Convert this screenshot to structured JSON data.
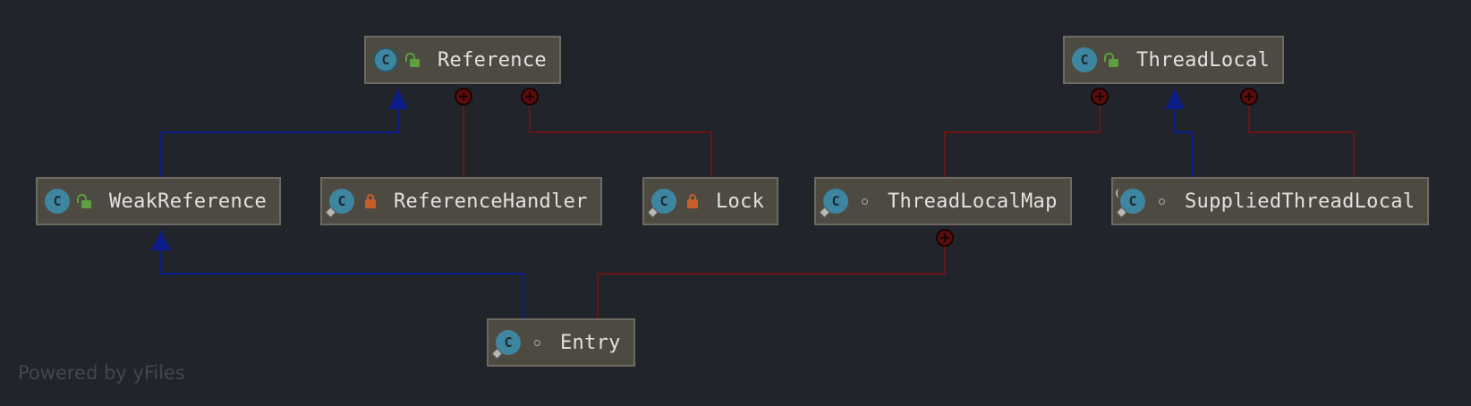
{
  "diagram": {
    "nodes": [
      {
        "id": "reference",
        "label": "Reference",
        "visibility": "public",
        "kind": "abstract-class"
      },
      {
        "id": "threadlocal",
        "label": "ThreadLocal",
        "visibility": "public",
        "kind": "class"
      },
      {
        "id": "weakreference",
        "label": "WeakReference",
        "visibility": "public",
        "kind": "class"
      },
      {
        "id": "referencehandler",
        "label": "ReferenceHandler",
        "visibility": "private",
        "kind": "static-class"
      },
      {
        "id": "lock",
        "label": "Lock",
        "visibility": "private",
        "kind": "static-class"
      },
      {
        "id": "threadlocalmap",
        "label": "ThreadLocalMap",
        "visibility": "package",
        "kind": "static-class"
      },
      {
        "id": "suppliedthreadlocal",
        "label": "SuppliedThreadLocal",
        "visibility": "package",
        "kind": "static-final-class"
      },
      {
        "id": "entry",
        "label": "Entry",
        "visibility": "package",
        "kind": "static-class"
      }
    ],
    "edges": [
      {
        "type": "extends",
        "from": "weakreference",
        "to": "reference"
      },
      {
        "type": "extends",
        "from": "entry",
        "to": "weakreference"
      },
      {
        "type": "extends",
        "from": "suppliedthreadlocal",
        "to": "threadlocal"
      },
      {
        "type": "inner",
        "from": "referencehandler",
        "to": "reference"
      },
      {
        "type": "inner",
        "from": "lock",
        "to": "reference"
      },
      {
        "type": "inner",
        "from": "threadlocalmap",
        "to": "threadlocal"
      },
      {
        "type": "inner",
        "from": "suppliedthreadlocal",
        "to": "threadlocal"
      },
      {
        "type": "inner",
        "from": "entry",
        "to": "threadlocalmap"
      }
    ],
    "icon_letter": "C",
    "colors": {
      "background": "#21252b",
      "extends": "#0d1e8a",
      "inner": "#6b1414",
      "node_fill": "#4d4a42",
      "node_border": "#6d6a63",
      "class_icon": "#3e86a0"
    }
  },
  "watermark": "Powered by yFiles"
}
